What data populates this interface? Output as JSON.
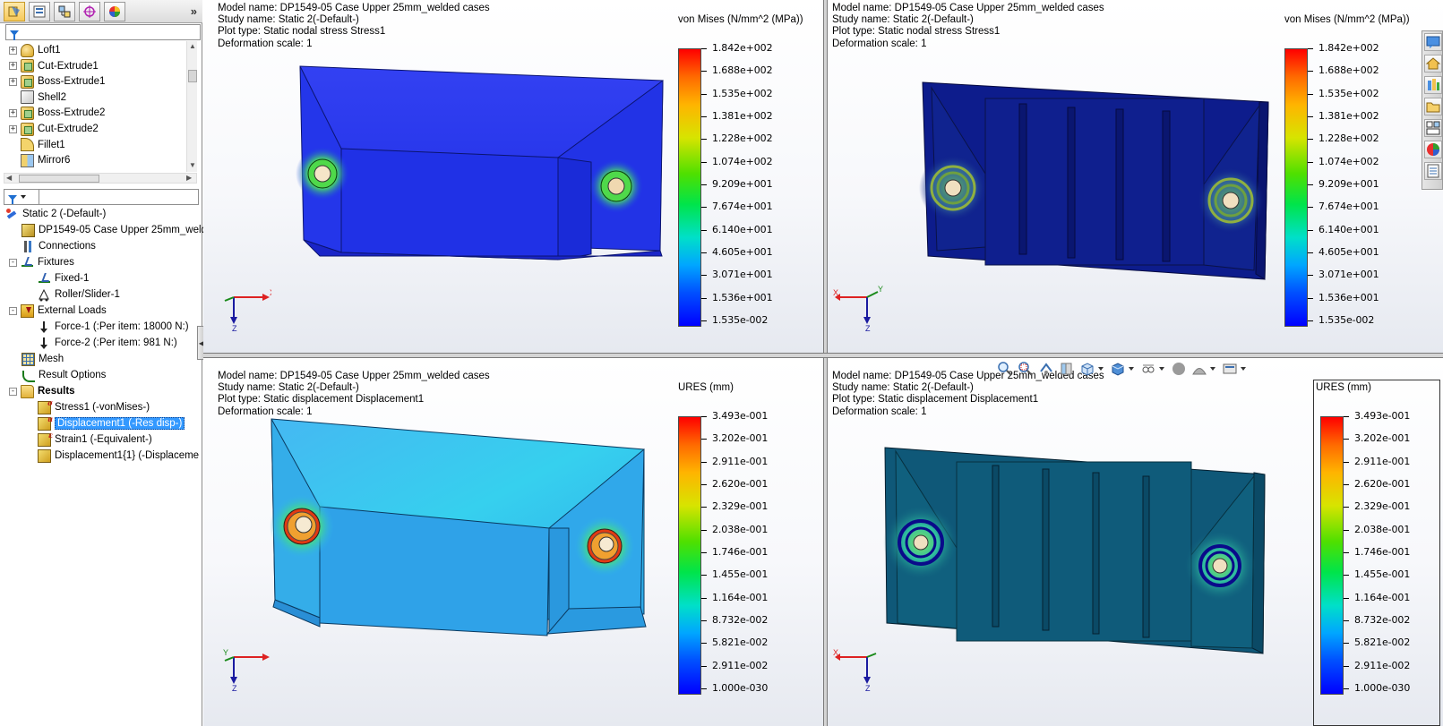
{
  "feature_tree": {
    "items": [
      {
        "label": "Loft1",
        "icon": "loft-icon",
        "expandable": true
      },
      {
        "label": "Cut-Extrude1",
        "icon": "cut-extrude-icon",
        "expandable": true
      },
      {
        "label": "Boss-Extrude1",
        "icon": "boss-extrude-icon",
        "expandable": true
      },
      {
        "label": "Shell2",
        "icon": "shell-icon",
        "expandable": false
      },
      {
        "label": "Boss-Extrude2",
        "icon": "boss-extrude-icon",
        "expandable": true
      },
      {
        "label": "Cut-Extrude2",
        "icon": "cut-extrude-icon",
        "expandable": true
      },
      {
        "label": "Fillet1",
        "icon": "fillet-icon",
        "expandable": false
      },
      {
        "label": "Mirror6",
        "icon": "mirror-icon",
        "expandable": false
      }
    ]
  },
  "study_tree": {
    "study": "Static 2 (-Default-)",
    "part": "DP1549-05 Case Upper 25mm_weld",
    "connections": "Connections",
    "fixtures": "Fixtures",
    "fixed": "Fixed-1",
    "roller": "Roller/Slider-1",
    "external_loads": "External Loads",
    "force1": "Force-1 (:Per item: 18000 N:)",
    "force2": "Force-2 (:Per item: 981 N:)",
    "mesh": "Mesh",
    "result_options": "Result Options",
    "results": "Results",
    "stress1": "Stress1 (-vonMises-)",
    "displacement1": "Displacement1 (-Res disp-)",
    "strain1": "Strain1 (-Equivalent-)",
    "displacement1_1": "Displacement1{1} (-Displaceme"
  },
  "viewports": [
    {
      "model_name": "Model name: DP1549-05 Case Upper 25mm_welded cases",
      "study_name": "Study name: Static 2(-Default-)",
      "plot_type": "Plot type: Static nodal stress Stress1",
      "deformation": "Deformation scale: 1",
      "legend_title": "von Mises (N/mm^2 (MPa))",
      "legend_values": [
        "1.842e+002",
        "1.688e+002",
        "1.535e+002",
        "1.381e+002",
        "1.228e+002",
        "1.074e+002",
        "9.209e+001",
        "7.674e+001",
        "6.140e+001",
        "4.605e+001",
        "3.071e+001",
        "1.536e+001",
        "1.535e-002"
      ]
    },
    {
      "model_name": "Model name: DP1549-05 Case Upper 25mm_welded cases",
      "study_name": "Study name: Static 2(-Default-)",
      "plot_type": "Plot type: Static nodal stress Stress1",
      "deformation": "Deformation scale: 1",
      "legend_title": "von Mises (N/mm^2 (MPa))",
      "legend_values": [
        "1.842e+002",
        "1.688e+002",
        "1.535e+002",
        "1.381e+002",
        "1.228e+002",
        "1.074e+002",
        "9.209e+001",
        "7.674e+001",
        "6.140e+001",
        "4.605e+001",
        "3.071e+001",
        "1.536e+001",
        "1.535e-002"
      ]
    },
    {
      "model_name": "Model name: DP1549-05 Case Upper 25mm_welded cases",
      "study_name": "Study name: Static 2(-Default-)",
      "plot_type": "Plot type: Static displacement Displacement1",
      "deformation": "Deformation scale: 1",
      "legend_title": "URES (mm)",
      "legend_values": [
        "3.493e-001",
        "3.202e-001",
        "2.911e-001",
        "2.620e-001",
        "2.329e-001",
        "2.038e-001",
        "1.746e-001",
        "1.455e-001",
        "1.164e-001",
        "8.732e-002",
        "5.821e-002",
        "2.911e-002",
        "1.000e-030"
      ]
    },
    {
      "model_name": "Model name: DP1549-05 Case Upper 25mm_welded cases",
      "study_name": "Study name: Static 2(-Default-)",
      "plot_type": "Plot type: Static displacement Displacement1",
      "deformation": "Deformation scale: 1",
      "legend_title": "URES (mm)",
      "legend_values": [
        "3.493e-001",
        "3.202e-001",
        "2.911e-001",
        "2.620e-001",
        "2.329e-001",
        "2.038e-001",
        "1.746e-001",
        "1.455e-001",
        "1.164e-001",
        "8.732e-002",
        "5.821e-002",
        "2.911e-002",
        "1.000e-030"
      ]
    }
  ],
  "triad_labels": {
    "x": "X",
    "y": "Y",
    "z": "Z"
  },
  "colors": {
    "model_blue_stress": "#1a2fe0",
    "model_dark_stress": "#0c1a8a",
    "model_cyan_disp": "#2fb1ee",
    "model_teal_disp": "#0f5d7e",
    "selection": "#3399ff"
  }
}
